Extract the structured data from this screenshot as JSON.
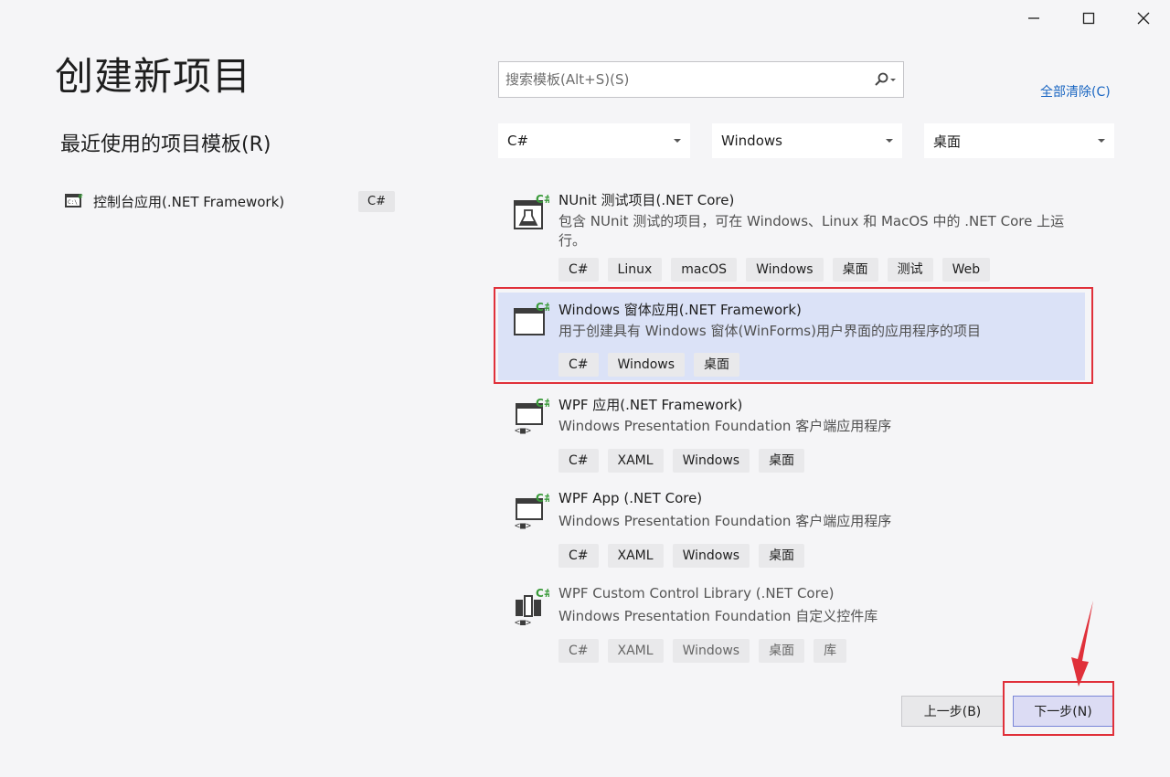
{
  "window": {
    "minimize_label": "—",
    "maximize_label": "□",
    "close_label": "✕"
  },
  "page": {
    "title": "创建新项目",
    "recent_title": "最近使用的项目模板(R)"
  },
  "recent": [
    {
      "label": "控制台应用(.NET Framework)",
      "lang": "C#",
      "icon": "console-app-icon"
    }
  ],
  "search": {
    "placeholder": "搜索模板(Alt+S)(S)",
    "value": ""
  },
  "clear_all": "全部清除(C)",
  "filters": {
    "language": "C#",
    "platform": "Windows",
    "project_type": "桌面"
  },
  "templates": [
    {
      "name": "NUnit 测试项目(.NET Core)",
      "description": "包含 NUnit 测试的项目，可在 Windows、Linux 和 MacOS 中的 .NET Core 上运行。",
      "tags": [
        "C#",
        "Linux",
        "macOS",
        "Windows",
        "桌面",
        "测试",
        "Web"
      ],
      "icon": "nunit-test-icon",
      "selected": false
    },
    {
      "name": "Windows 窗体应用(.NET Framework)",
      "description": "用于创建具有 Windows 窗体(WinForms)用户界面的应用程序的项目",
      "tags": [
        "C#",
        "Windows",
        "桌面"
      ],
      "icon": "winforms-app-icon",
      "selected": true
    },
    {
      "name": "WPF 应用(.NET Framework)",
      "description": "Windows Presentation Foundation 客户端应用程序",
      "tags": [
        "C#",
        "XAML",
        "Windows",
        "桌面"
      ],
      "icon": "wpf-app-icon",
      "selected": false
    },
    {
      "name": "WPF App (.NET Core)",
      "description": "Windows Presentation Foundation 客户端应用程序",
      "tags": [
        "C#",
        "XAML",
        "Windows",
        "桌面"
      ],
      "icon": "wpf-app-icon",
      "selected": false
    },
    {
      "name": "WPF Custom Control Library (.NET Core)",
      "description": "Windows Presentation Foundation 自定义控件库",
      "tags": [
        "C#",
        "XAML",
        "Windows",
        "桌面",
        "库"
      ],
      "icon": "wpf-control-library-icon",
      "selected": false
    }
  ],
  "buttons": {
    "back": "上一步(B)",
    "next": "下一步(N)"
  },
  "colors": {
    "accent": "#1a66c2",
    "selection_bg": "#dbe2f7",
    "annotation_red": "#e0303a",
    "csharp_green": "#3a9a3a"
  }
}
